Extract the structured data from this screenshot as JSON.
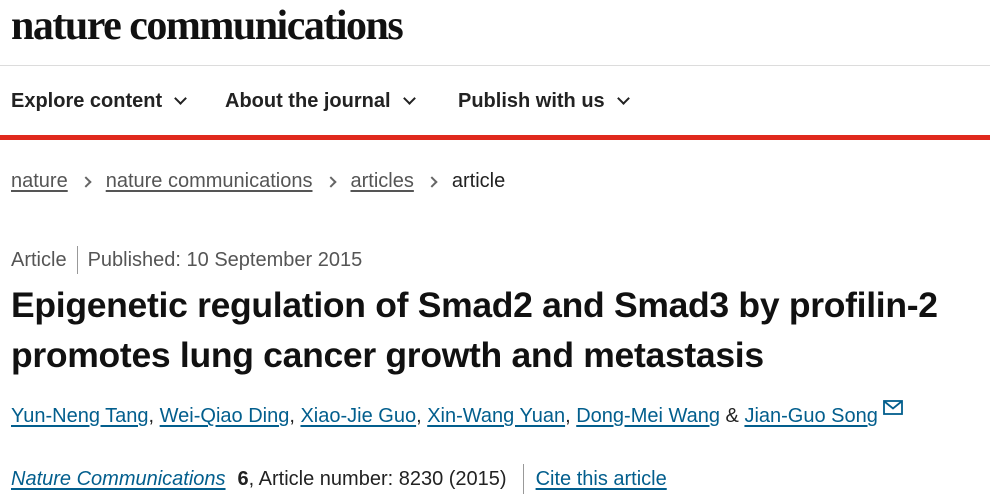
{
  "site": {
    "logo": "nature communications"
  },
  "nav": {
    "items": [
      {
        "label": "Explore content"
      },
      {
        "label": "About the journal"
      },
      {
        "label": "Publish with us"
      }
    ],
    "accent_color": "#e0291d"
  },
  "breadcrumb": {
    "items": [
      {
        "label": "nature"
      },
      {
        "label": "nature communications"
      },
      {
        "label": "articles"
      }
    ],
    "current": "article"
  },
  "article": {
    "type": "Article",
    "published": "Published: 10 September 2015",
    "title": "Epigenetic regulation of Smad2 and Smad3 by profilin-2 promotes lung cancer growth and metastasis",
    "authors": [
      "Yun-Neng Tang",
      "Wei-Qiao Ding",
      "Xiao-Jie Guo",
      "Xin-Wang Yuan",
      "Dong-Mei Wang",
      "Jian-Guo Song"
    ],
    "author_separator": ", ",
    "author_last_separator": " & ",
    "corresponding_icon": "envelope-icon",
    "journal": "Nature Communications",
    "volume": "6",
    "article_number": ", Article number: 8230 (2015)",
    "cite_label": "Cite this article",
    "link_color": "#025e8d"
  }
}
